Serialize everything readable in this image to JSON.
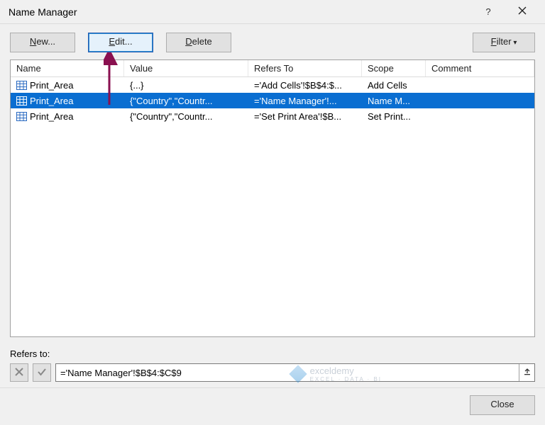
{
  "titlebar": {
    "title": "Name Manager"
  },
  "toolbar": {
    "new_label_pre": "N",
    "new_label_post": "ew...",
    "edit_label_pre": "E",
    "edit_label_post": "dit...",
    "delete_label_pre": "D",
    "delete_label_post": "elete",
    "filter_label_pre": "F",
    "filter_label_post": "ilter"
  },
  "columns": {
    "name": "Name",
    "value": "Value",
    "refers": "Refers To",
    "scope": "Scope",
    "comment": "Comment"
  },
  "rows": [
    {
      "name": "Print_Area",
      "value": "{...}",
      "refers": "='Add Cells'!$B$4:$...",
      "scope": "Add Cells",
      "comment": ""
    },
    {
      "name": "Print_Area",
      "value": "{\"Country\",\"Countr...",
      "refers": "='Name Manager'!...",
      "scope": "Name M...",
      "comment": ""
    },
    {
      "name": "Print_Area",
      "value": "{\"Country\",\"Countr...",
      "refers": "='Set Print Area'!$B...",
      "scope": "Set Print...",
      "comment": ""
    }
  ],
  "selected_row": 1,
  "refersto": {
    "label": "Refers to:",
    "value": "='Name Manager'!$B$4:$C$9"
  },
  "footer": {
    "close_label": "Close"
  },
  "watermark": {
    "brand": "exceldemy",
    "tagline": "EXCEL · DATA · BI"
  }
}
